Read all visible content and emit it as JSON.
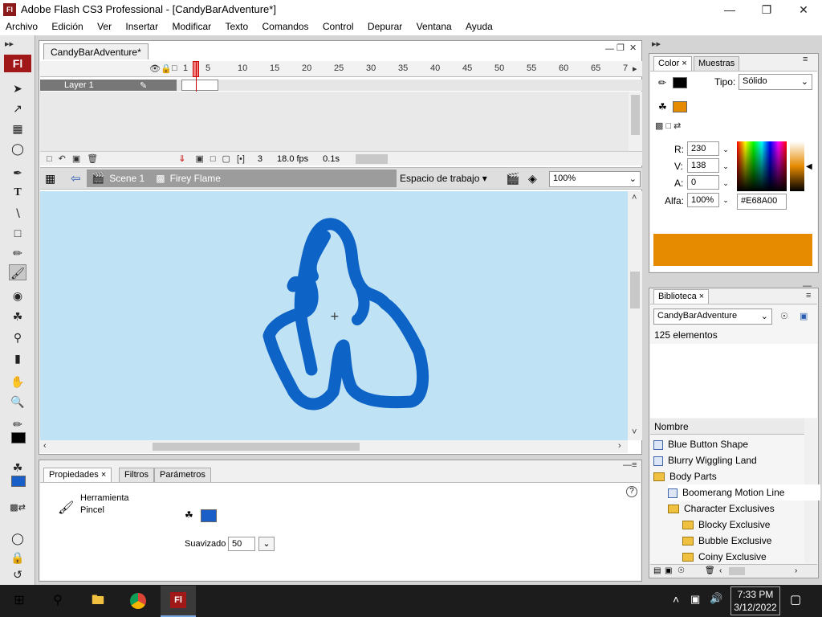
{
  "window": {
    "app_logo": "Fl",
    "title": "Adobe Flash CS3 Professional - [CandyBarAdventure*]",
    "controls": [
      "minimize-icon",
      "maximize-icon",
      "close-icon"
    ]
  },
  "menu": [
    "Archivo",
    "Edición",
    "Ver",
    "Insertar",
    "Modificar",
    "Texto",
    "Comandos",
    "Control",
    "Depurar",
    "Ventana",
    "Ayuda"
  ],
  "tools": {
    "logo": "Fl",
    "items": [
      "selection-arrow-icon",
      "subselection-icon",
      "free-transform-icon",
      "lasso-icon",
      "pen-icon",
      "text-icon",
      "line-icon",
      "rectangle-icon",
      "pencil-icon",
      "brush-icon",
      "ink-bottle-icon",
      "paint-bucket-icon",
      "eyedropper-icon",
      "eraser-icon",
      "hand-icon",
      "zoom-icon"
    ]
  },
  "document": {
    "tab": "CandyBarAdventure*",
    "frame_numbers": [
      "1",
      "5",
      "10",
      "15",
      "20",
      "25",
      "30",
      "35",
      "40",
      "45",
      "50",
      "55",
      "60",
      "65",
      "7"
    ],
    "layer": "Layer 1",
    "footer": {
      "frame": "3",
      "fps": "18.0 fps",
      "time": "0.1s"
    },
    "breadcrumb": [
      "Scene 1",
      "Firey Flame"
    ],
    "workspace": "Espacio de trabajo",
    "zoom": "100%"
  },
  "properties": {
    "tabs": [
      "Propiedades",
      "Filtros",
      "Parámetros"
    ],
    "tool_name_line1": "Herramienta",
    "tool_name_line2": "Pincel",
    "smoothing_label": "Suavizado",
    "smoothing_value": "50",
    "fill_color": "#1a5fc8"
  },
  "color": {
    "tabs": [
      "Color",
      "Muestras"
    ],
    "type_label": "Tipo:",
    "type_value": "Sólido",
    "r_label": "R:",
    "r_value": "230",
    "g_label": "V:",
    "g_value": "138",
    "b_label": "A:",
    "b_value": "0",
    "alpha_label": "Alfa:",
    "alpha_value": "100%",
    "hex": "#E68A00",
    "swatch": "#E68A00"
  },
  "library": {
    "tab": "Biblioteca",
    "document": "CandyBarAdventure",
    "count": "125 elementos",
    "column": "Nombre",
    "items": [
      {
        "name": "Blue Button Shape",
        "kind": "symbol",
        "indent": 0
      },
      {
        "name": "Blurry Wiggling Land",
        "kind": "symbol",
        "indent": 0
      },
      {
        "name": "Body Parts",
        "kind": "folder",
        "indent": 0
      },
      {
        "name": "Boomerang Motion Line",
        "kind": "symbol",
        "indent": 1
      },
      {
        "name": "Character Exclusives",
        "kind": "folder",
        "indent": 1
      },
      {
        "name": "Blocky Exclusive",
        "kind": "folder",
        "indent": 2
      },
      {
        "name": "Bubble Exclusive",
        "kind": "folder",
        "indent": 2
      },
      {
        "name": "Coiny Exclusive",
        "kind": "folder",
        "indent": 2
      }
    ]
  },
  "taskbar": {
    "time": "7:33 PM",
    "date": "3/12/2022",
    "flash_label": "Fl"
  }
}
